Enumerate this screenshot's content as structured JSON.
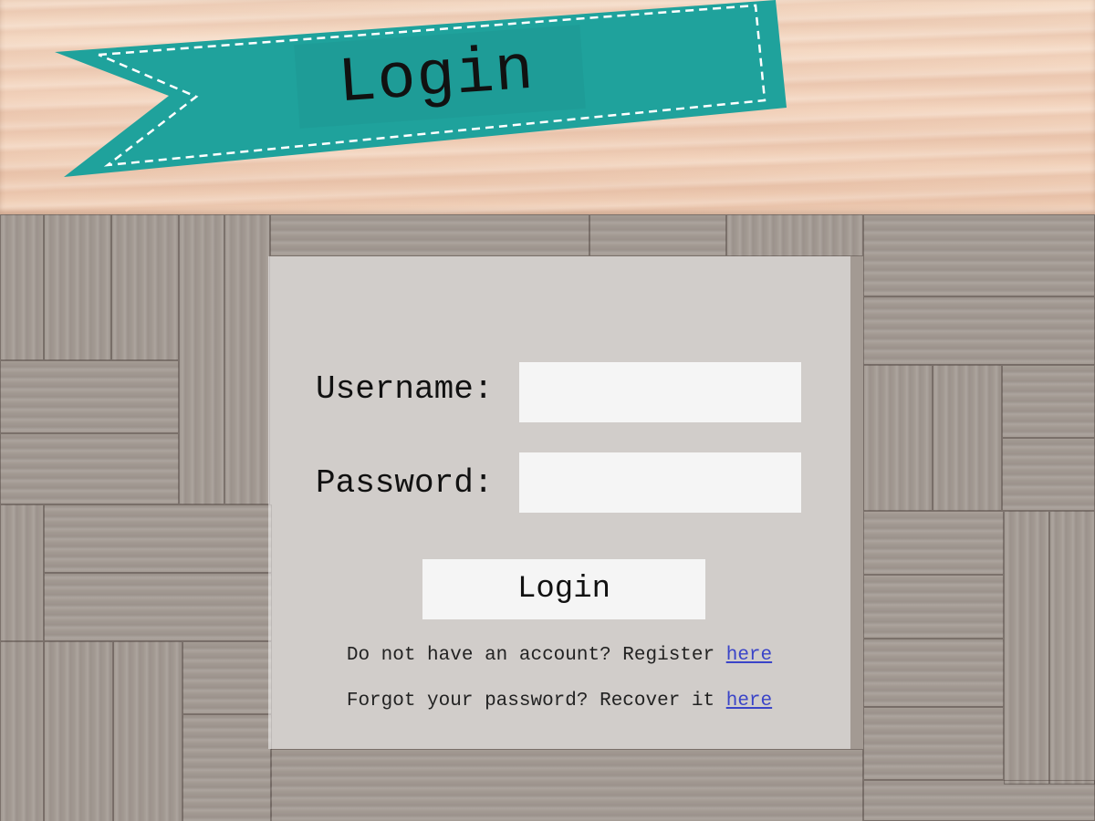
{
  "header": {
    "banner_title": "Login"
  },
  "form": {
    "username_label": "Username:",
    "username_value": "",
    "password_label": "Password:",
    "password_value": "",
    "login_button_label": "Login"
  },
  "links": {
    "register_text": "Do not have an account? Register",
    "register_link": "here",
    "recover_text": "Forgot your password? Recover it",
    "recover_link": "here"
  },
  "colors": {
    "banner_teal": "#1fa29c",
    "link_blue": "#3a44c8",
    "header_wood": "#f4d6c0"
  }
}
